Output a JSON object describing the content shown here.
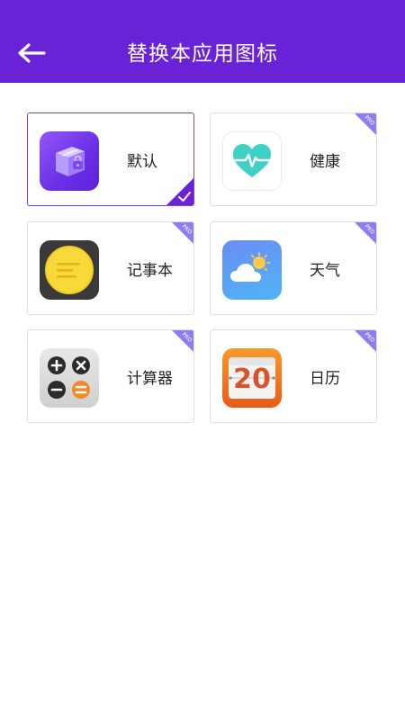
{
  "header": {
    "title": "替换本应用图标",
    "back_icon": "arrow-left-icon",
    "background": "#6a22d6"
  },
  "icons": [
    {
      "label": "默认",
      "icon": "default-app-icon",
      "pro": false,
      "selected": true
    },
    {
      "label": "健康",
      "icon": "health-heart-icon",
      "pro": true,
      "selected": false
    },
    {
      "label": "记事本",
      "icon": "notepad-icon",
      "pro": true,
      "selected": false
    },
    {
      "label": "天气",
      "icon": "weather-icon",
      "pro": true,
      "selected": false
    },
    {
      "label": "计算器",
      "icon": "calculator-icon",
      "pro": true,
      "selected": false
    },
    {
      "label": "日历",
      "icon": "calendar-icon",
      "pro": true,
      "selected": false,
      "calendar_day": "20"
    }
  ],
  "badge": {
    "pro_text": "PRO",
    "color": "#8d7df0"
  },
  "selected_color": "#6a22d6"
}
